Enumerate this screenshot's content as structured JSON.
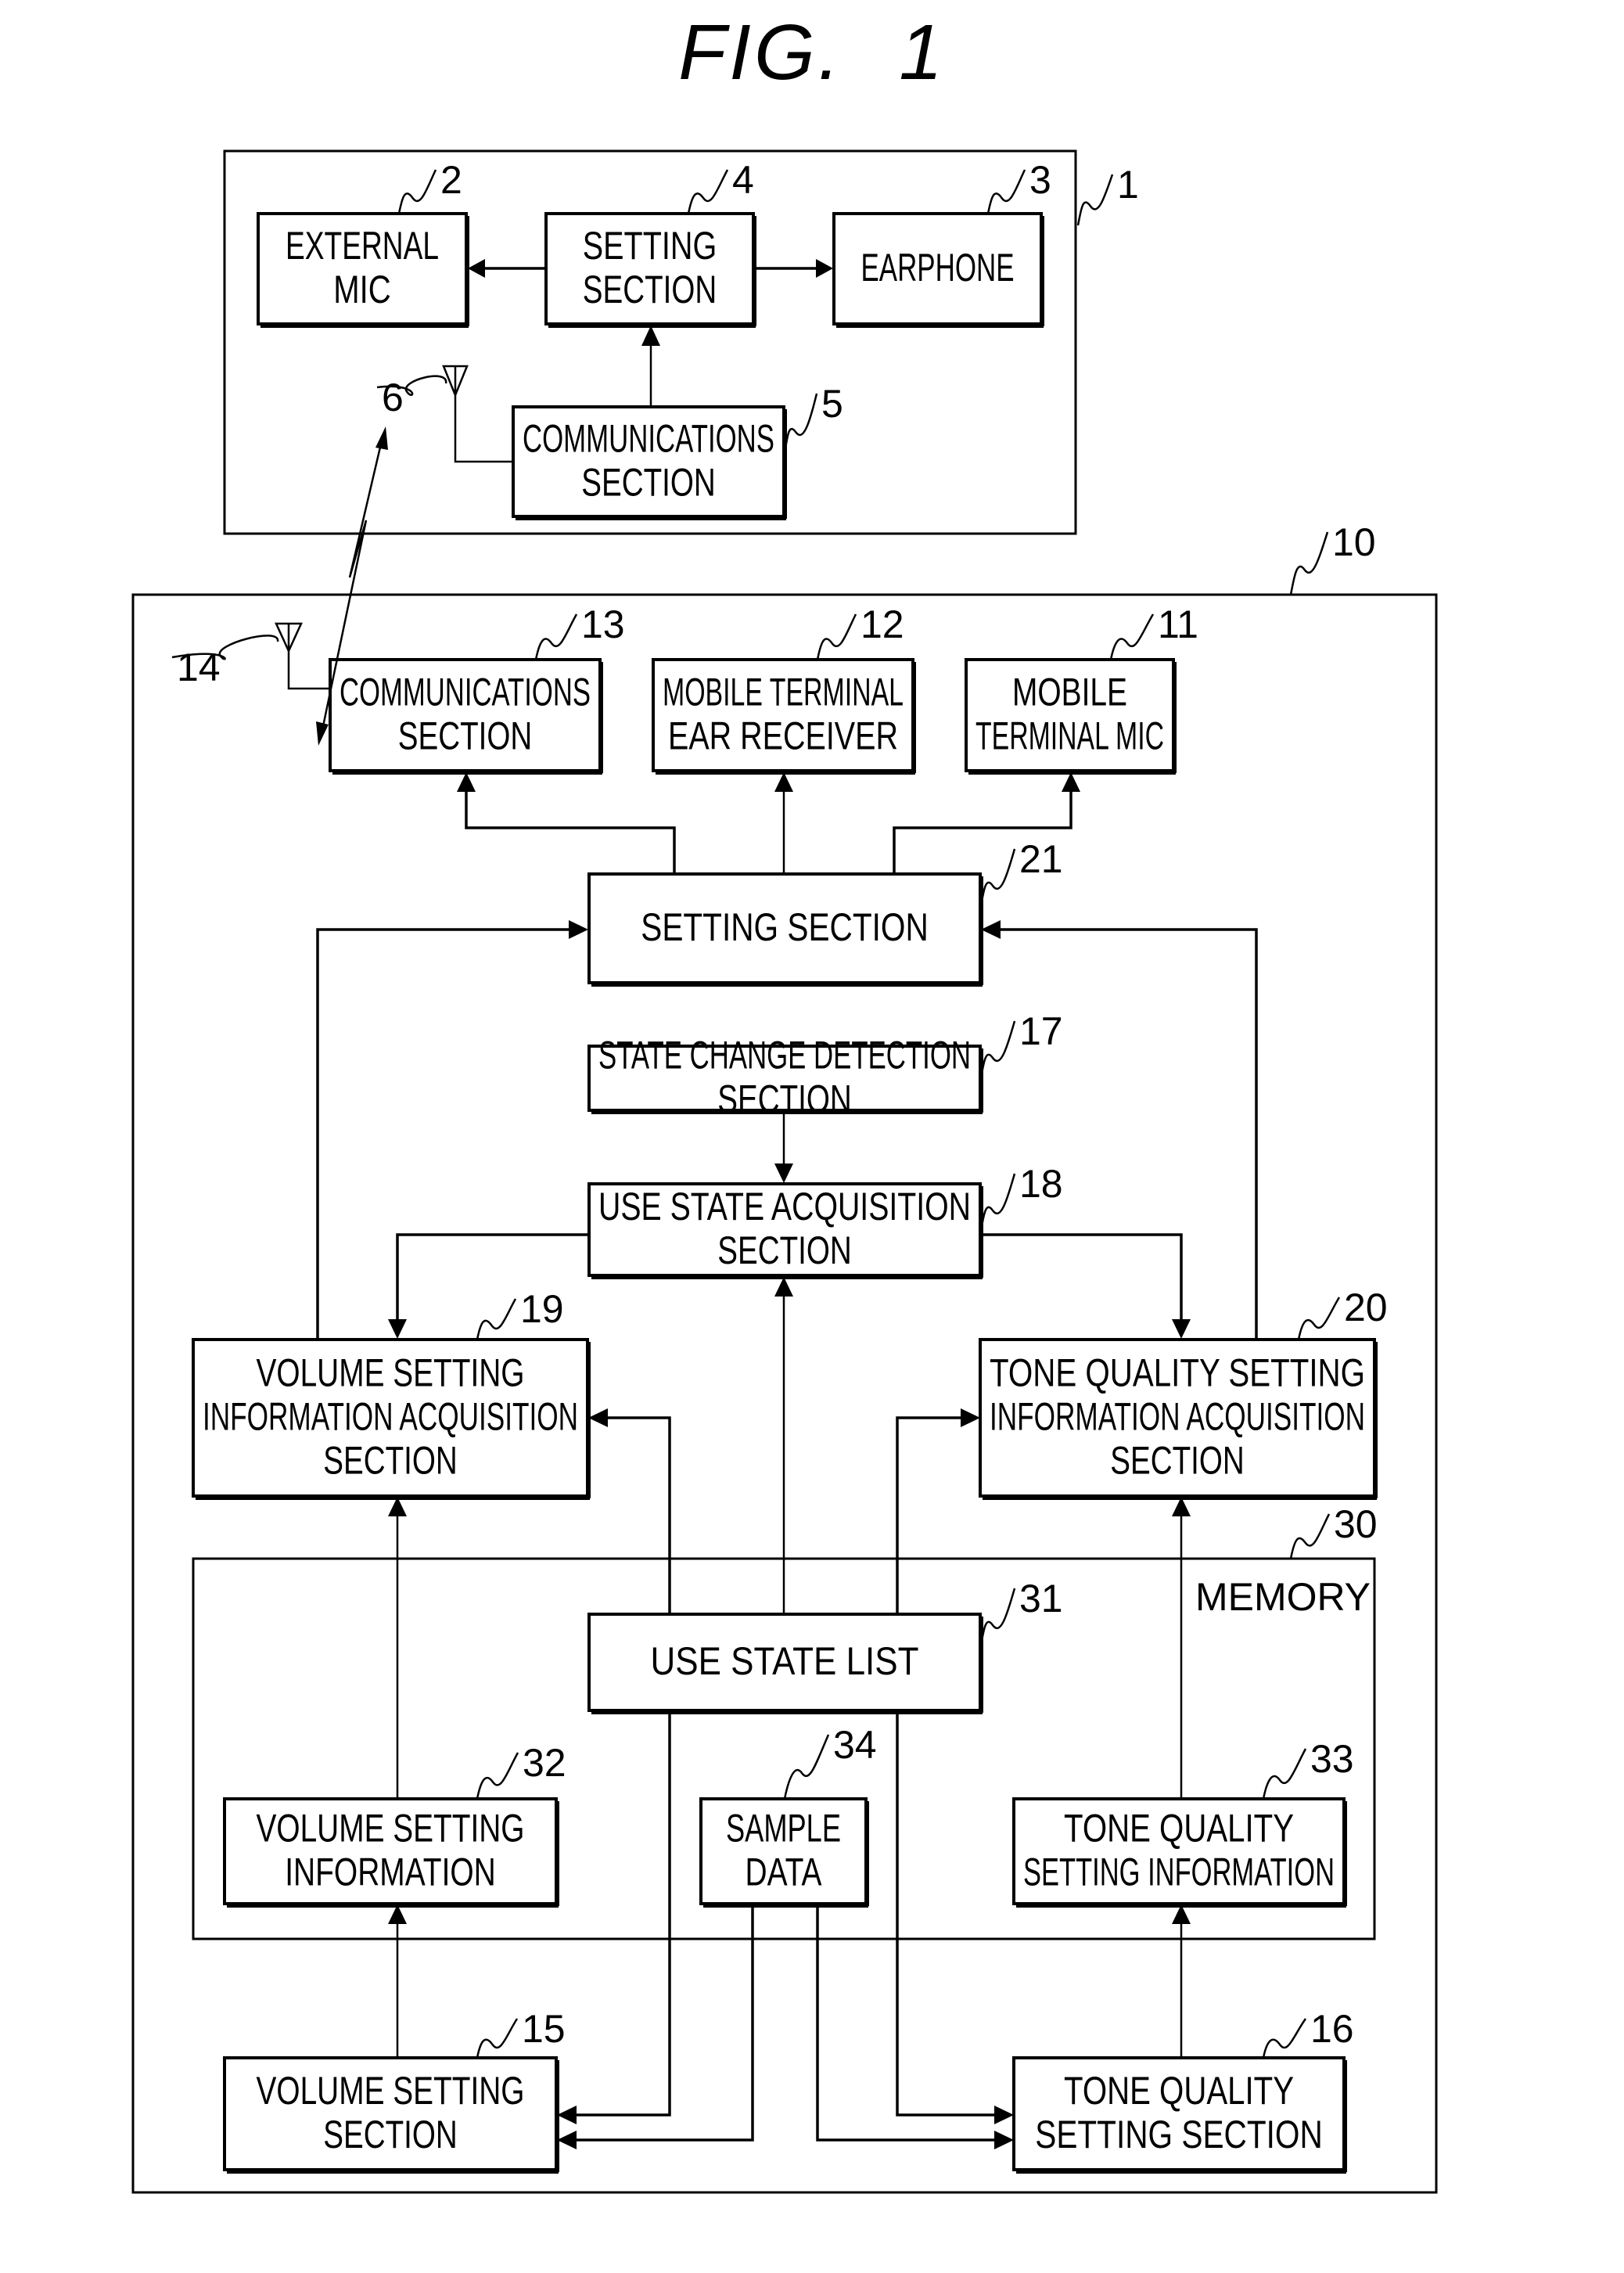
{
  "figure": {
    "title": "FIG.  1"
  },
  "devices": {
    "headset": {
      "ref": "1"
    },
    "terminal": {
      "ref": "10"
    }
  },
  "blocks": {
    "external_mic": {
      "ref": "2",
      "lines": [
        "EXTERNAL",
        "MIC"
      ]
    },
    "earphone": {
      "ref": "3",
      "lines": [
        "EARPHONE"
      ]
    },
    "headset_setting": {
      "ref": "4",
      "lines": [
        "SETTING",
        "SECTION"
      ]
    },
    "headset_comm": {
      "ref": "5",
      "lines": [
        "COMMUNICATIONS",
        "SECTION"
      ]
    },
    "headset_antenna": {
      "ref": "6"
    },
    "terminal_mic": {
      "ref": "11",
      "lines": [
        "MOBILE",
        "TERMINAL MIC"
      ]
    },
    "terminal_ear": {
      "ref": "12",
      "lines": [
        "MOBILE TERMINAL",
        "EAR RECEIVER"
      ]
    },
    "terminal_comm": {
      "ref": "13",
      "lines": [
        "COMMUNICATIONS",
        "SECTION"
      ]
    },
    "terminal_antenna": {
      "ref": "14"
    },
    "volume_setting": {
      "ref": "15",
      "lines": [
        "VOLUME SETTING",
        "SECTION"
      ]
    },
    "tone_setting": {
      "ref": "16",
      "lines": [
        "TONE QUALITY",
        "SETTING SECTION"
      ]
    },
    "state_change": {
      "ref": "17",
      "lines": [
        "STATE CHANGE DETECTION",
        "SECTION"
      ]
    },
    "use_state_acq": {
      "ref": "18",
      "lines": [
        "USE STATE ACQUISITION",
        "SECTION"
      ]
    },
    "volume_info_acq": {
      "ref": "19",
      "lines": [
        "VOLUME SETTING",
        "INFORMATION ACQUISITION",
        "SECTION"
      ]
    },
    "tone_info_acq": {
      "ref": "20",
      "lines": [
        "TONE QUALITY SETTING",
        "INFORMATION ACQUISITION",
        "SECTION"
      ]
    },
    "terminal_setting": {
      "ref": "21",
      "lines": [
        "SETTING SECTION"
      ]
    },
    "memory": {
      "ref": "30",
      "label": "MEMORY"
    },
    "use_state_list": {
      "ref": "31",
      "lines": [
        "USE STATE LIST"
      ]
    },
    "volume_info": {
      "ref": "32",
      "lines": [
        "VOLUME SETTING",
        "INFORMATION"
      ]
    },
    "tone_info": {
      "ref": "33",
      "lines": [
        "TONE QUALITY",
        "SETTING INFORMATION"
      ]
    },
    "sample_data": {
      "ref": "34",
      "lines": [
        "SAMPLE",
        "DATA"
      ]
    }
  }
}
